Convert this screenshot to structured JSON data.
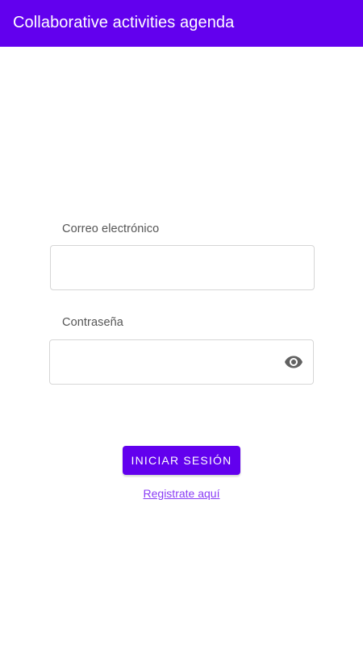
{
  "app_bar": {
    "title": "Collaborative activities agenda",
    "color": "#6200ee"
  },
  "login_form": {
    "email": {
      "label": "Correo electrónico",
      "value": ""
    },
    "password": {
      "label": "Contraseña",
      "value": "",
      "toggle_icon": "eye-icon"
    },
    "submit_label": "INICIAR SESIÓN",
    "register_link": "Registrate aquí"
  }
}
